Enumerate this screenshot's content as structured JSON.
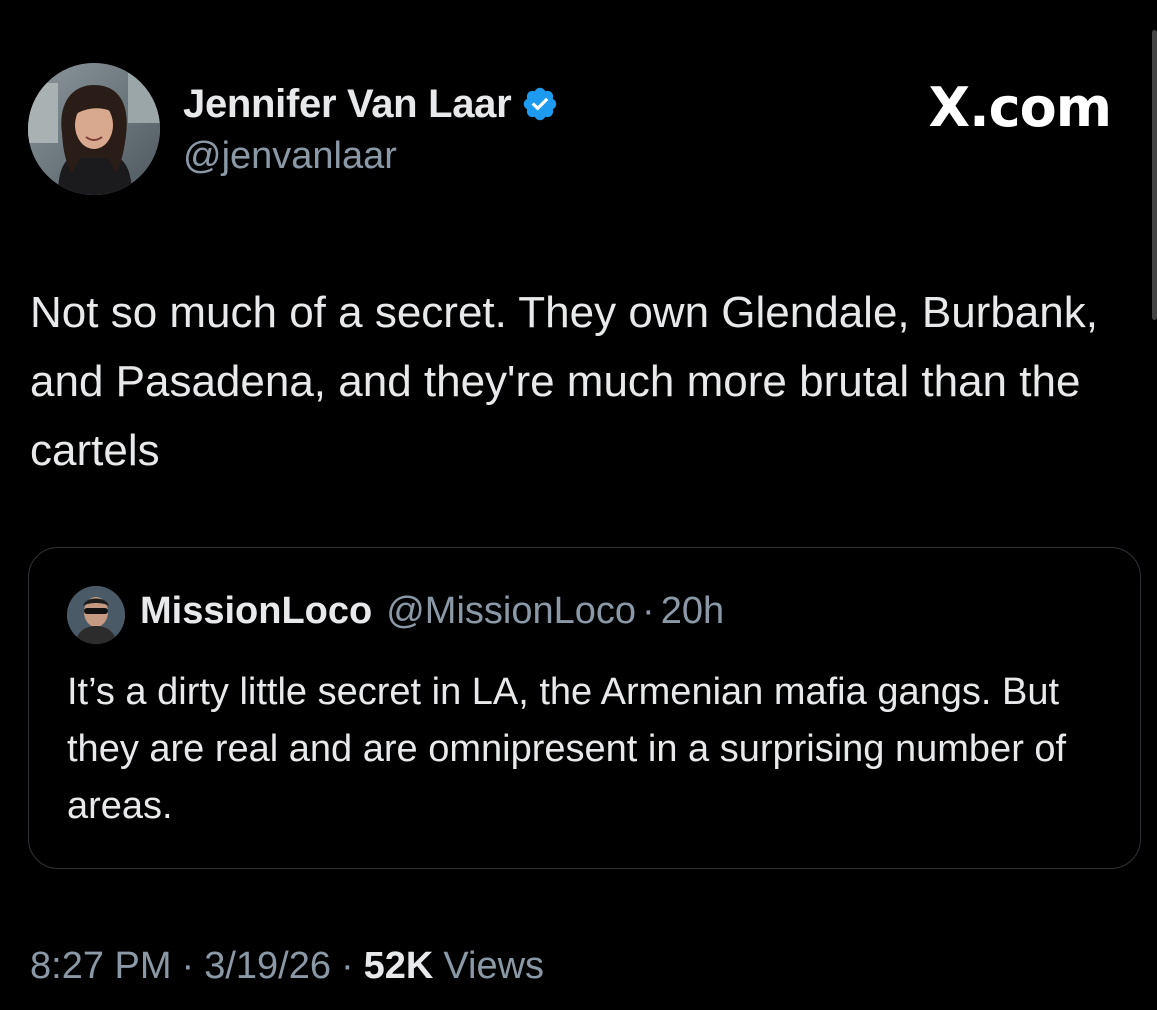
{
  "tweet": {
    "author": {
      "name": "Jennifer Van Laar",
      "handle": "@jenvanlaar",
      "verified": true
    },
    "brand_logo": "X.com",
    "text": "Not so much of a secret. They own Glendale, Burbank, and Pasadena, and they're much more brutal than the cartels",
    "quoted": {
      "name": "MissionLoco",
      "handle": "@MissionLoco",
      "separator": "·",
      "time": "20h",
      "text": "It’s a dirty little secret in LA, the Armenian mafia gangs.  But they are real and are omnipresent in a surprising number of areas."
    },
    "meta": {
      "time": "8:27 PM",
      "separator": "·",
      "date": "3/19/26",
      "views_count": "52K",
      "views_label": "Views"
    }
  },
  "colors": {
    "background": "#000000",
    "primary_text": "#e7e9ea",
    "secondary_text": "#8b98a5",
    "verified_blue": "#1d9bf0",
    "border": "#2f3336"
  },
  "icons": {
    "verified": "verified-badge-icon",
    "avatar": "profile-photo",
    "quote_avatar": "profile-photo"
  }
}
